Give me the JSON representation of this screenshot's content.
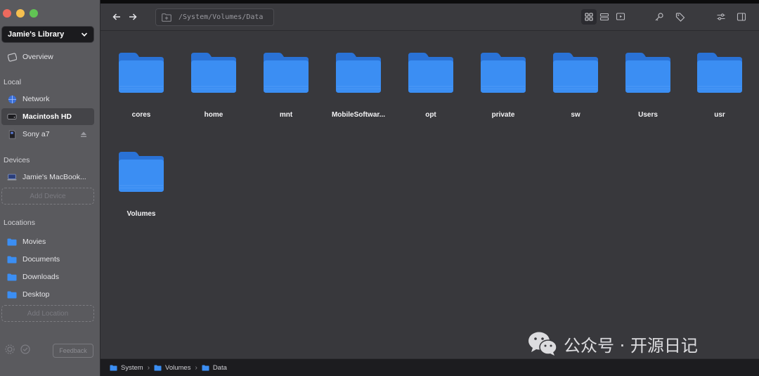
{
  "sidebar": {
    "library": "Jamie's Library",
    "overview": "Overview",
    "section_local": "Local",
    "network": "Network",
    "macintosh_hd": "Macintosh HD",
    "sony": "Sony a7",
    "section_devices": "Devices",
    "device": "Jamie's MacBook...",
    "add_device": "Add Device",
    "section_locations": "Locations",
    "locations": [
      "Movies",
      "Documents",
      "Downloads",
      "Desktop"
    ],
    "add_location": "Add Location",
    "feedback": "Feedback"
  },
  "toolbar": {
    "path": "/System/Volumes/Data"
  },
  "folders": [
    "cores",
    "home",
    "mnt",
    "MobileSoftwar...",
    "opt",
    "private",
    "sw",
    "Users",
    "usr",
    "Volumes"
  ],
  "statusbar": {
    "crumbs": [
      "System",
      "Volumes",
      "Data"
    ]
  },
  "watermark": {
    "text": "公众号 · 开源日记"
  },
  "colors": {
    "folder_blue": "#3b8ef3",
    "sidebar_bg": "#5a5a5e",
    "main_bg": "#38383c"
  }
}
